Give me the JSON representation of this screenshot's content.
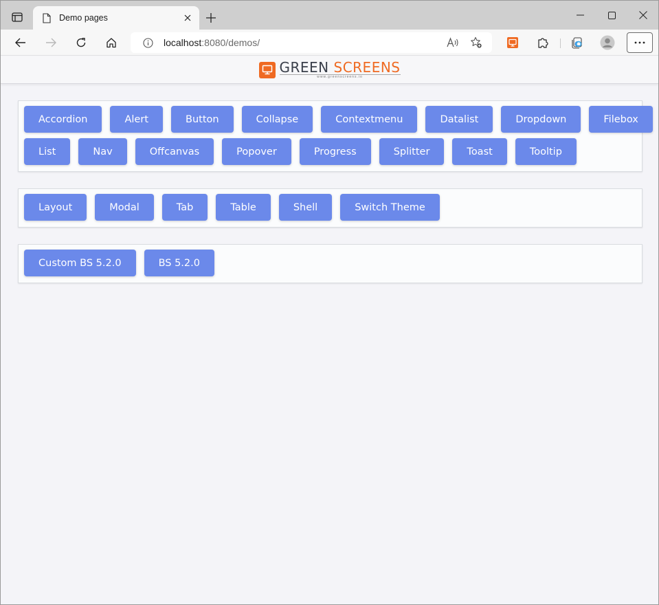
{
  "browser": {
    "tab_title": "Demo pages",
    "url_host": "localhost",
    "url_rest": ":8080/demos/"
  },
  "logo": {
    "word1": "GREEN",
    "word2": "SCREENS",
    "tagline": "www.greenscreens.io",
    "accent": "#ef6a22"
  },
  "groups": [
    {
      "rows": [
        [
          "Accordion",
          "Alert",
          "Button",
          "Collapse",
          "Contextmenu",
          "Datalist",
          "Dropdown",
          "Filebox"
        ],
        [
          "List",
          "Nav",
          "Offcanvas",
          "Popover",
          "Progress",
          "Splitter",
          "Toast",
          "Tooltip"
        ]
      ]
    },
    {
      "rows": [
        [
          "Layout",
          "Modal",
          "Tab",
          "Table",
          "Shell",
          "Switch Theme"
        ]
      ]
    },
    {
      "rows": [
        [
          "Custom BS 5.2.0",
          "BS 5.2.0"
        ]
      ]
    }
  ],
  "colors": {
    "button_bg": "#6b89ea",
    "button_text": "#ffffff",
    "page_bg": "#f4f4f8"
  },
  "icons": {
    "tab_actions": "tab-actions-icon",
    "page": "page-icon",
    "close": "close-icon",
    "new_tab": "plus-icon",
    "back": "back-arrow-icon",
    "forward": "forward-arrow-icon",
    "reload": "reload-icon",
    "home": "home-icon",
    "info": "info-icon",
    "read_aloud": "read-aloud-icon",
    "favorites": "add-favorite-icon",
    "extension": "greenscreens-extension-icon",
    "extensions": "puzzle-icon",
    "collections": "collections-icon",
    "profile": "profile-icon",
    "more": "more-icon"
  }
}
